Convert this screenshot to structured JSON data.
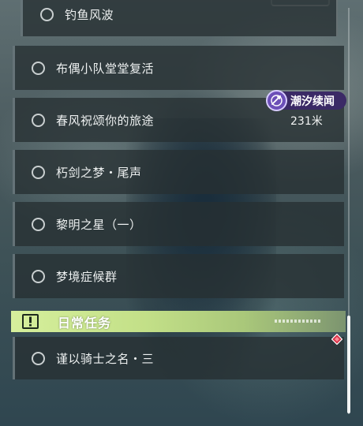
{
  "quest_list": {
    "items": [
      {
        "label": "钓鱼风波"
      },
      {
        "label": "布偶小队堂堂复活"
      },
      {
        "label": "春风祝颂你的旅途"
      },
      {
        "label": "朽剑之梦・尾声"
      },
      {
        "label": "黎明之星（一）"
      },
      {
        "label": "梦境症候群"
      }
    ],
    "tracked_badge": {
      "text": "潮汐续闻",
      "icon": "swordsman-emblem-icon",
      "distance": "231米"
    }
  },
  "daily_section": {
    "title": "日常任务",
    "icon": "exclamation-box-icon",
    "items": [
      {
        "label": "谨以骑士之名・三",
        "marker": "red-diamond-icon"
      }
    ]
  },
  "colors": {
    "badge_bg": "#3b2a66",
    "badge_icon": "#6c4fb8",
    "section_header": "#d6ef9c",
    "marker_red": "#d9344a"
  }
}
